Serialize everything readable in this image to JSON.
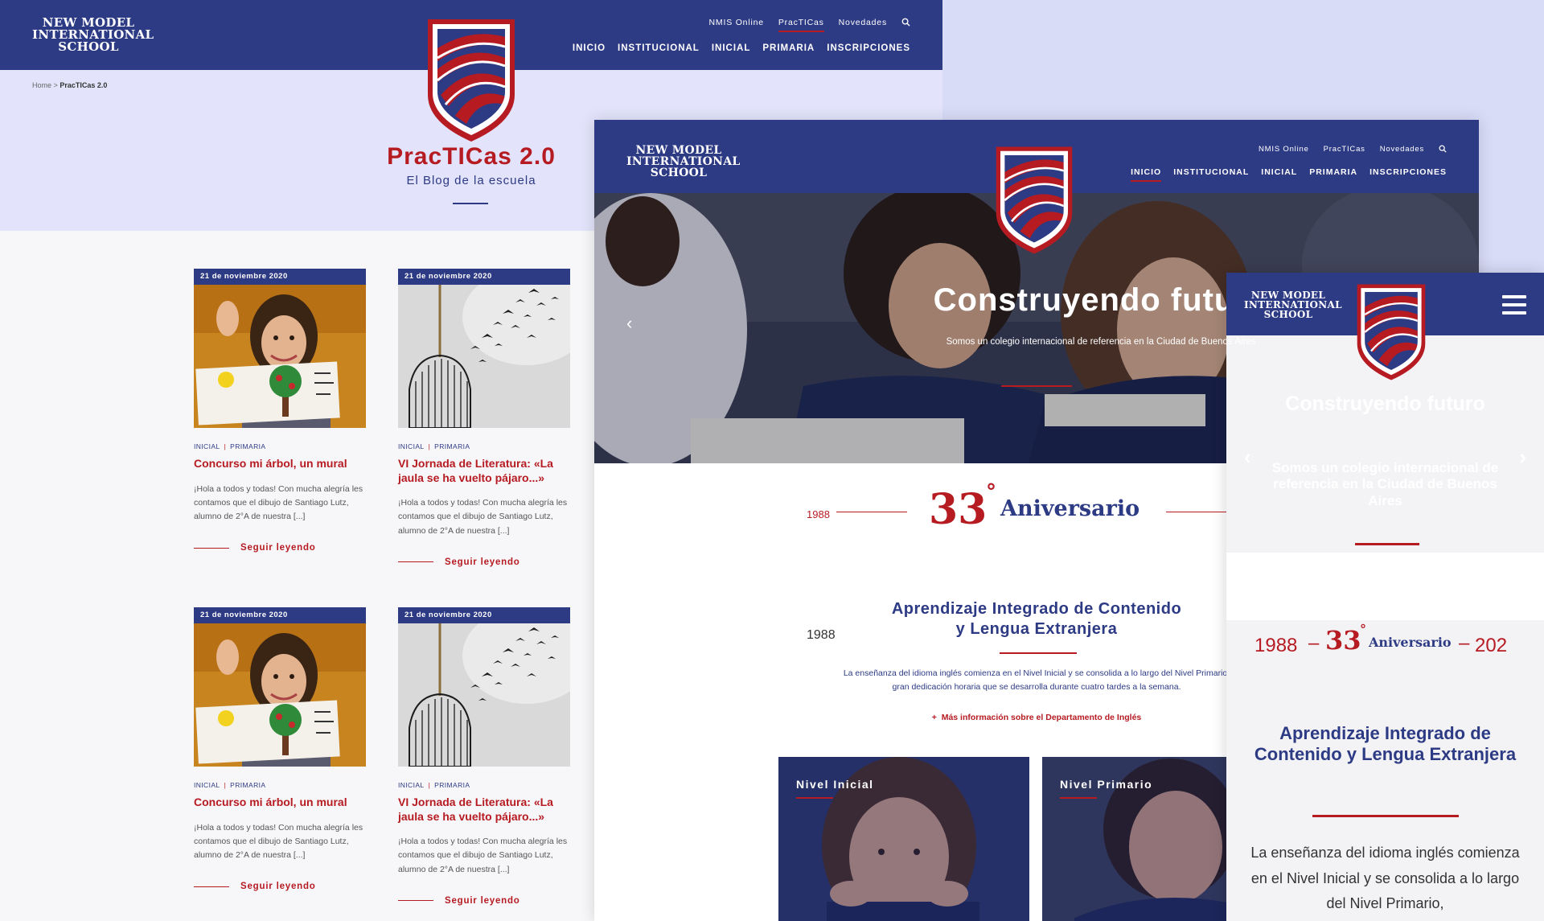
{
  "colors": {
    "navy": "#2d3a84",
    "red": "#b61b22",
    "lavender": "#e3e4fb"
  },
  "brand": {
    "line1": "NEW MODEL",
    "line2": "INTERNATIONAL",
    "line3": "SCHOOL"
  },
  "nav": {
    "top": [
      "NMIS Online",
      "PracTICas",
      "Novedades"
    ],
    "main": [
      "INICIO",
      "INSTITUCIONAL",
      "INICIAL",
      "PRIMARIA",
      "INSCRIPCIONES"
    ],
    "search_icon": "search-icon"
  },
  "blog": {
    "breadcrumb_home": "Home",
    "breadcrumb_sep": ">",
    "breadcrumb_current": "PracTICas 2.0",
    "title": "PracTICas 2.0",
    "subtitle": "El Blog de la escuela",
    "cards": [
      {
        "date": "21 de noviembre 2020",
        "cat1": "INICIAL",
        "cat2": "PRIMARIA",
        "title": "Concurso mi árbol, un mural",
        "excerpt": "¡Hola a todos y todas! Con mucha alegría les contamos que el dibujo de Santiago Lutz, alumno de 2°A de nuestra [...]",
        "more": "Seguir leyendo"
      },
      {
        "date": "21 de noviembre 2020",
        "cat1": "INICIAL",
        "cat2": "PRIMARIA",
        "title": "VI Jornada de Literatura: «La jaula se ha vuelto pájaro...»",
        "excerpt": "¡Hola a todos y todas! Con mucha alegría les contamos que el dibujo de Santiago Lutz, alumno de 2°A de nuestra [...]",
        "more": "Seguir leyendo"
      },
      {
        "date": "21 de noviembre 2020",
        "cat1": "INICIAL",
        "cat2": "PRIMARIA",
        "title": "Concurso mi árbol, un mural",
        "excerpt": "¡Hola a todos y todas! Con mucha alegría les contamos que el dibujo de Santiago Lutz, alumno de 2°A de nuestra [...]",
        "more": "Seguir leyendo"
      },
      {
        "date": "21 de noviembre 2020",
        "cat1": "INICIAL",
        "cat2": "PRIMARIA",
        "title": "VI Jornada de Literatura: «La jaula se ha vuelto pájaro...»",
        "excerpt": "¡Hola a todos y todas! Con mucha alegría les contamos que el dibujo de Santiago Lutz, alumno de 2°A de nuestra [...]",
        "more": "Seguir leyendo"
      }
    ]
  },
  "home": {
    "hero_title": "Construyendo futuro",
    "hero_subtitle": "Somos un colegio internacional de referencia en la Ciudad de Buenos Aires",
    "anniv_year": "1988",
    "anniv_number": "33",
    "anniv_degree": "°",
    "anniv_word": "Aniversario",
    "intro_title_l1": "Aprendizaje Integrado de Contenido",
    "intro_title_l2": "y Lengua Extranjera",
    "intro_text_l1": "La enseñanza del idioma inglés comienza en el Nivel Inicial y se consolida a lo largo del Nivel Primario,",
    "intro_text_l2": "gran dedicación horaria que se desarrolla durante cuatro tardes a la semana.",
    "intro_link": "Más información sobre el Departamento de Inglés",
    "level1": "Nivel Inicial",
    "level2": "Nivel Primario"
  },
  "mobile": {
    "hero_title": "Construyendo futuro",
    "hero_subtitle": "Somos un colegio internacional de referencia en la Ciudad de Buenos Aires",
    "anniv_start": "1988",
    "anniv_number": "33",
    "anniv_degree": "°",
    "anniv_word": "Aniversario",
    "anniv_end": "202",
    "intro_title": "Aprendizaje Integrado de Contenido y Lengua Extranjera",
    "intro_text": "La enseñanza del idioma inglés comienza en el Nivel Inicial y se consolida a lo largo del Nivel Primario,"
  }
}
